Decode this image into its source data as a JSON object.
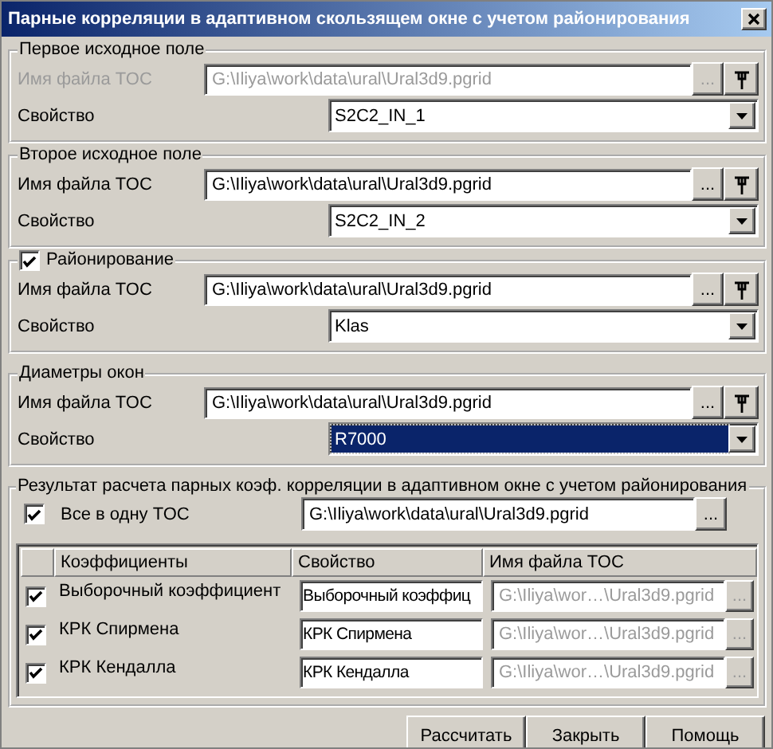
{
  "window": {
    "title": "Парные корреляции в адаптивном скользящем окне с учетом районирования"
  },
  "source_groups": [
    {
      "kind": "plain",
      "title": "Первое исходное поле",
      "file_label": "Имя файла TOC",
      "file_path": "G:\\Iliya\\work\\data\\ural\\Ural3d9.pgrid",
      "disabled": true,
      "browse": "...",
      "property_label": "Свойство",
      "property": "S2C2_IN_1",
      "highlighted": false
    },
    {
      "kind": "plain",
      "title": "Второе исходное поле",
      "file_label": "Имя файла TOC",
      "file_path": "G:\\Iliya\\work\\data\\ural\\Ural3d9.pgrid",
      "disabled": false,
      "browse": "...",
      "property_label": "Свойство",
      "property": "S2C2_IN_2",
      "highlighted": false
    },
    {
      "kind": "checkable",
      "checked": true,
      "title": "Районирование",
      "file_label": "Имя файла TOC",
      "file_path": "G:\\Iliya\\work\\data\\ural\\Ural3d9.pgrid",
      "disabled": false,
      "browse": "...",
      "property_label": "Свойство",
      "property": "Klas",
      "highlighted": false
    },
    {
      "kind": "plain",
      "title": "Диаметры окон",
      "file_label": "Имя файла TOC",
      "file_path": "G:\\Iliya\\work\\data\\ural\\Ural3d9.pgrid",
      "disabled": false,
      "browse": "...",
      "property_label": "Свойство",
      "property": "R7000",
      "highlighted": true
    }
  ],
  "result": {
    "title": "Результат расчета парных коэф. корреляции в адаптивном окне с учетом районирования",
    "all_in_one": {
      "label": "Все в одну TOC",
      "checked": true,
      "file_path": "G:\\Iliya\\work\\data\\ural\\Ural3d9.pgrid",
      "browse": "..."
    },
    "table": {
      "columns": [
        "Коэффициенты",
        "Свойство",
        "Имя файла TOC"
      ],
      "rows": [
        {
          "checked": true,
          "name": "Выборочный коэффициент",
          "property": "Выборочный коэффиц",
          "file_path": "G:\\Iliya\\wor…\\Ural3d9.pgrid",
          "disabled": true,
          "browse": "..."
        },
        {
          "checked": true,
          "name": "КРК Спирмена",
          "property": "КРК Спирмена",
          "file_path": "G:\\Iliya\\wor…\\Ural3d9.pgrid",
          "disabled": true,
          "browse": "..."
        },
        {
          "checked": true,
          "name": "КРК Кендалла",
          "property": "КРК Кендалла",
          "file_path": "G:\\Iliya\\wor…\\Ural3d9.pgrid",
          "disabled": true,
          "browse": "..."
        }
      ]
    }
  },
  "buttons": [
    "Рассчитать",
    "Закрыть",
    "Помощь"
  ]
}
